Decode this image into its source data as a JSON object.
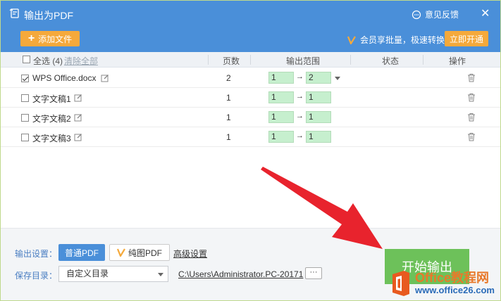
{
  "window": {
    "title": "输出为PDF",
    "feedback_label": "意见反馈",
    "close_glyph": "✕"
  },
  "toolbar": {
    "add_file_label": "添加文件",
    "member_promo": "会员享批量，极速转换",
    "open_now_label": "立即开通"
  },
  "table": {
    "headers": {
      "select_all": "全选 (4)",
      "clear_all": "清除全部",
      "pages": "页数",
      "output_range": "输出范围",
      "status": "状态",
      "actions": "操作"
    },
    "rows": [
      {
        "name": "WPS Office.docx",
        "checked": true,
        "pages": "2",
        "range_from": "1",
        "range_to": "2",
        "arrow": "→"
      },
      {
        "name": "文字文稿1",
        "checked": false,
        "pages": "1",
        "range_from": "1",
        "range_to": "1",
        "arrow": "→"
      },
      {
        "name": "文字文稿2",
        "checked": false,
        "pages": "1",
        "range_from": "1",
        "range_to": "1",
        "arrow": "→"
      },
      {
        "name": "文字文稿3",
        "checked": false,
        "pages": "1",
        "range_from": "1",
        "range_to": "1",
        "arrow": "→"
      }
    ]
  },
  "bottom": {
    "output_settings_label": "输出设置：",
    "normal_pdf_label": "普通PDF",
    "image_pdf_label": "纯图PDF",
    "advanced_settings_label": "高级设置",
    "save_dir_label": "保存目录：",
    "save_dir_value": "自定义目录",
    "save_path": "C:\\Users\\Administrator.PC-20171",
    "more_label": "···",
    "start_output_label": "开始输出"
  },
  "watermark": {
    "line1": "Office教程网",
    "line2": "www.office26.com"
  },
  "colors": {
    "titlebar": "#4a8fd9",
    "accent_orange": "#f5a93b",
    "range_green": "#c6efce",
    "start_green": "#6dc15a",
    "arrow_red": "#e8232d"
  }
}
